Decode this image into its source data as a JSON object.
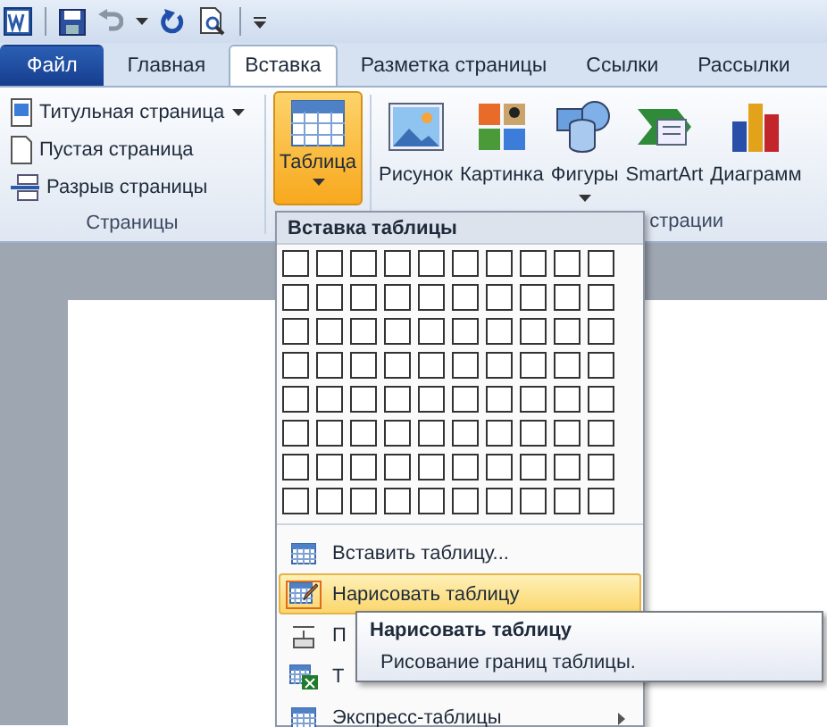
{
  "tabs": [
    {
      "label": "Файл",
      "kind": "file",
      "selected": false
    },
    {
      "label": "Главная",
      "kind": "tab",
      "selected": false
    },
    {
      "label": "Вставка",
      "kind": "tab",
      "selected": true
    },
    {
      "label": "Разметка страницы",
      "kind": "tab",
      "selected": false
    },
    {
      "label": "Ссылки",
      "kind": "tab",
      "selected": false
    },
    {
      "label": "Рассылки",
      "kind": "tab",
      "selected": false
    }
  ],
  "pages_group": {
    "label": "Страницы",
    "items": [
      {
        "label": "Титульная страница",
        "dropdown": true
      },
      {
        "label": "Пустая страница",
        "dropdown": false
      },
      {
        "label": "Разрыв страницы",
        "dropdown": false
      }
    ]
  },
  "table_button": {
    "label": "Таблица",
    "selected": true,
    "dropdown": true
  },
  "illustrations_group": {
    "label": "страции",
    "buttons": [
      {
        "label": "Рисунок",
        "dropdown": false
      },
      {
        "label": "Картинка",
        "dropdown": false
      },
      {
        "label": "Фигуры",
        "dropdown": true
      },
      {
        "label": "SmartArt",
        "dropdown": false
      },
      {
        "label": "Диаграмм",
        "dropdown": false
      }
    ]
  },
  "table_menu": {
    "header": "Вставка таблицы",
    "items": [
      {
        "label": "Вставить таблицу...",
        "selected": false,
        "submenu": false
      },
      {
        "label": "Нарисовать таблицу",
        "selected": true,
        "submenu": false
      },
      {
        "label": "П",
        "selected": false,
        "submenu": false
      },
      {
        "label": "Т",
        "selected": false,
        "submenu": false
      },
      {
        "label": "Экспресс-таблицы",
        "selected": false,
        "submenu": true
      }
    ]
  },
  "tooltip": {
    "title": "Нарисовать таблицу",
    "description": "Рисование границ таблицы."
  }
}
